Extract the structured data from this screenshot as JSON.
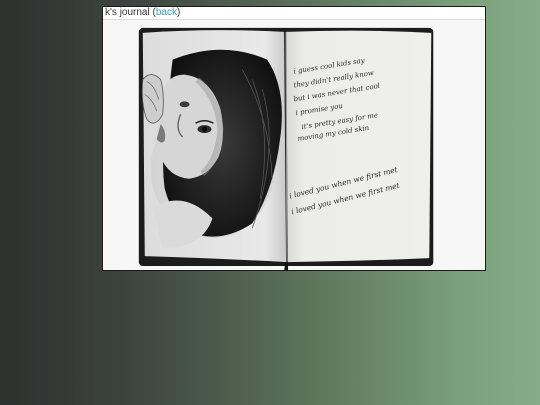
{
  "window": {
    "title_prefix": "k's journal (",
    "back_link": "back",
    "title_suffix": ")"
  },
  "journal_lines": [
    "i guess cool kids say",
    "they didn't really know",
    "but i was never that cool",
    "i promise you",
    "it's pretty easy for me",
    "moving my cold skin",
    "i loved you when we first met",
    "i loved you when we first met"
  ],
  "colors": {
    "link": "#3a9fc4",
    "page": "#eeeeea",
    "ink": "#2a2a2a"
  }
}
